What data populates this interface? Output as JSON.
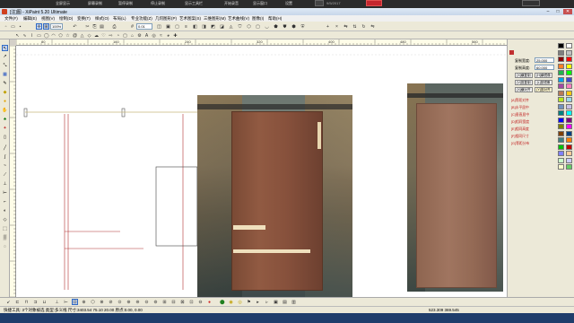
{
  "topbar": {
    "items": [
      "全屏显示",
      "屏幕录制",
      "暂停录制",
      "停止录制",
      "显示工具栏",
      "开始录音",
      "显示窗口",
      "设置"
    ],
    "date": "9/5/2017"
  },
  "window": {
    "title": "[注]图 - XiPaint 5.20 Ultimate",
    "min_symbol": "–",
    "max_symbol": "□",
    "close_symbol": "✕"
  },
  "menubar": {
    "items": [
      "文件(F)",
      "编辑(E)",
      "视图(V)",
      "绘制(D)",
      "变换(T)",
      "样式(O)",
      "布局(L)",
      "专业功能(Z)",
      "几何图形(P)",
      "艺术图案(S)",
      "三维图形(M)",
      "艺术曲线(V)",
      "图像(I)",
      "帮助(H)"
    ]
  },
  "toolbar1": {
    "combo_value": "100%",
    "line_combo": "0.01"
  },
  "hruler": {
    "labels": [
      "80",
      "160",
      "240",
      "320",
      "400",
      "480",
      "560",
      "640",
      "720",
      "800",
      "880"
    ]
  },
  "vruler": {
    "labels": [
      "40",
      "80",
      "120",
      "160",
      "200",
      "240",
      "280"
    ]
  },
  "rightpanel": {
    "width_label": "复制宽度:",
    "width_value": "25.000",
    "height_label": "复制高度:",
    "height_value": "60.000",
    "btn_h_copy": "[X]横复制",
    "btn_h_mirror": "[H]横镜像",
    "btn_v_copy": "[V]竖复制",
    "btn_v_mirror": "[L]竖镜像",
    "btn_h_align": "[X]横对齐",
    "btn_v_align": "[Y]竖对齐",
    "red_items": [
      "[A]等距对齐",
      "[B]水平居中",
      "[C]垂直居中",
      "[D]相同宽度",
      "[E]相同高度",
      "[F]相同尺寸",
      "[G]等距分布"
    ]
  },
  "palette": {
    "colors": [
      "#000000",
      "#ffffff",
      "#7f7f7f",
      "#c0c0c0",
      "#880000",
      "#ff0000",
      "#ff7f27",
      "#ffff00",
      "#22b14c",
      "#00ff00",
      "#00a2e8",
      "#3f48cc",
      "#a349a4",
      "#ff80c0",
      "#b97a57",
      "#ffc90e",
      "#b5e61d",
      "#99d9ea",
      "#7092be",
      "#c8bfe7",
      "#008080",
      "#00ffff",
      "#0000ff",
      "#800080",
      "#808000",
      "#ff00ff",
      "#804000",
      "#004080",
      "#408080",
      "#ff8000",
      "#00c000",
      "#c00000",
      "#8080ff",
      "#ffcc99",
      "#ccffcc",
      "#ccccff",
      "#ffffcc",
      "#66cc66"
    ]
  },
  "statusbar": {
    "left_text": "快捷工具: 3个对象被选  类型:多义线  尺寸:3403.54 75.10 20.00  原点:0.00, 0.00",
    "right_coords": "523.309 369.545"
  },
  "icons": {
    "select": "arrow-icon",
    "node": "node-edit-icon",
    "zoom": "zoom-icon",
    "pen": "pen-icon",
    "rect": "rectangle-icon",
    "ellipse": "ellipse-icon",
    "text": "text-icon",
    "fill": "fill-icon"
  }
}
